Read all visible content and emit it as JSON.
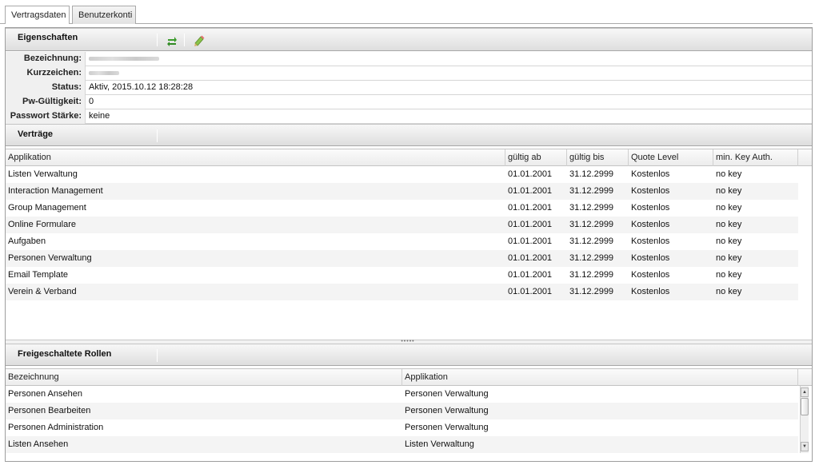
{
  "tabs": [
    {
      "label": "Vertragsdaten",
      "active": true
    },
    {
      "label": "Benutzerkonti",
      "active": false
    }
  ],
  "eigenschaften": {
    "title": "Eigenschaften",
    "toolbar_icons": [
      "refresh-icon",
      "pencil-icon"
    ],
    "fields": [
      {
        "label": "Bezeichnung:",
        "value": "",
        "redacted": true
      },
      {
        "label": "Kurzzeichen:",
        "value": "",
        "redacted": true
      },
      {
        "label": "Status:",
        "value": "Aktiv, 2015.10.12 18:28:28"
      },
      {
        "label": "Pw-Gültigkeit:",
        "value": "0"
      },
      {
        "label": "Passwort Stärke:",
        "value": "keine"
      }
    ]
  },
  "vertraege": {
    "title": "Verträge",
    "columns": [
      "Applikation",
      "gültig ab",
      "gültig bis",
      "Quote Level",
      "min. Key Auth."
    ],
    "rows": [
      [
        "Listen Verwaltung",
        "01.01.2001",
        "31.12.2999",
        "Kostenlos",
        "no key"
      ],
      [
        "Interaction Management",
        "01.01.2001",
        "31.12.2999",
        "Kostenlos",
        "no key"
      ],
      [
        "Group Management",
        "01.01.2001",
        "31.12.2999",
        "Kostenlos",
        "no key"
      ],
      [
        "Online Formulare",
        "01.01.2001",
        "31.12.2999",
        "Kostenlos",
        "no key"
      ],
      [
        "Aufgaben",
        "01.01.2001",
        "31.12.2999",
        "Kostenlos",
        "no key"
      ],
      [
        "Personen Verwaltung",
        "01.01.2001",
        "31.12.2999",
        "Kostenlos",
        "no key"
      ],
      [
        "Email Template",
        "01.01.2001",
        "31.12.2999",
        "Kostenlos",
        "no key"
      ],
      [
        "Verein & Verband",
        "01.01.2001",
        "31.12.2999",
        "Kostenlos",
        "no key"
      ]
    ]
  },
  "rollen": {
    "title": "Freigeschaltete Rollen",
    "columns": [
      "Bezeichnung",
      "Applikation"
    ],
    "rows": [
      [
        "Personen Ansehen",
        "Personen Verwaltung"
      ],
      [
        "Personen Bearbeiten",
        "Personen Verwaltung"
      ],
      [
        "Personen Administration",
        "Personen Verwaltung"
      ],
      [
        "Listen Ansehen",
        "Listen Verwaltung"
      ]
    ]
  },
  "colors": {
    "header_gradient_top": "#f7f7f7",
    "header_gradient_bottom": "#dedede",
    "alt_row": "#f4f4f4",
    "border": "#9e9e9e",
    "refresh_icon": "#3a9a2a",
    "pencil_icon": "#7cb342"
  }
}
